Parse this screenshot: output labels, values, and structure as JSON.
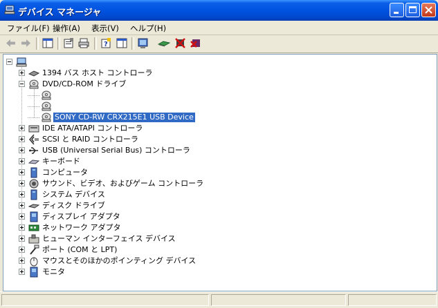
{
  "window": {
    "title": "デバイス マネージャ"
  },
  "menu": [
    {
      "label": "ファイル(F)"
    },
    {
      "label": "操作(A)"
    },
    {
      "label": "表示(V)"
    },
    {
      "label": "ヘルプ(H)"
    }
  ],
  "toolbar": {
    "buttons": [
      "back-arrow-icon",
      "forward-arrow-icon",
      "show-hide-tree-icon",
      "properties-icon",
      "print-icon",
      "help-icon",
      "view-icon",
      "scan-hardware-icon",
      "update-driver-icon",
      "disable-device-icon",
      "uninstall-device-icon"
    ]
  },
  "tree": {
    "root": {
      "label": ""
    },
    "categories": [
      {
        "label": "1394 バス ホスト コントローラ",
        "icon": "bus-controller-icon",
        "expanded": false
      },
      {
        "label": "DVD/CD-ROM ドライブ",
        "icon": "cdrom-icon",
        "expanded": true,
        "children": [
          {
            "label": "",
            "icon": "cdrom-icon"
          },
          {
            "label": "",
            "icon": "cdrom-icon"
          },
          {
            "label": "SONY CD-RW  CRX215E1 USB Device",
            "icon": "cdrom-icon",
            "selected": true
          }
        ]
      },
      {
        "label": "IDE ATA/ATAPI コントローラ",
        "icon": "ide-controller-icon",
        "expanded": false
      },
      {
        "label": "SCSI と RAID コントローラ",
        "icon": "scsi-icon",
        "expanded": false
      },
      {
        "label": "USB (Universal Serial Bus) コントローラ",
        "icon": "usb-icon",
        "expanded": false
      },
      {
        "label": "キーボード",
        "icon": "keyboard-icon",
        "expanded": false
      },
      {
        "label": "コンピュータ",
        "icon": "computer-icon",
        "expanded": false
      },
      {
        "label": "サウンド、ビデオ、およびゲーム コントローラ",
        "icon": "sound-icon",
        "expanded": false
      },
      {
        "label": "システム デバイス",
        "icon": "system-device-icon",
        "expanded": false
      },
      {
        "label": "ディスク ドライブ",
        "icon": "disk-drive-icon",
        "expanded": false
      },
      {
        "label": "ディスプレイ アダプタ",
        "icon": "display-adapter-icon",
        "expanded": false
      },
      {
        "label": "ネットワーク アダプタ",
        "icon": "network-adapter-icon",
        "expanded": false
      },
      {
        "label": "ヒューマン インターフェイス デバイス",
        "icon": "hid-icon",
        "expanded": false
      },
      {
        "label": "ポート (COM と LPT)",
        "icon": "port-icon",
        "expanded": false
      },
      {
        "label": "マウスとそのほかのポインティング デバイス",
        "icon": "mouse-icon",
        "expanded": false
      },
      {
        "label": "モニタ",
        "icon": "monitor-icon",
        "expanded": false
      }
    ]
  },
  "colors": {
    "titlebar": "#0053e0",
    "selection": "#316ac5",
    "face": "#ece9d8"
  }
}
